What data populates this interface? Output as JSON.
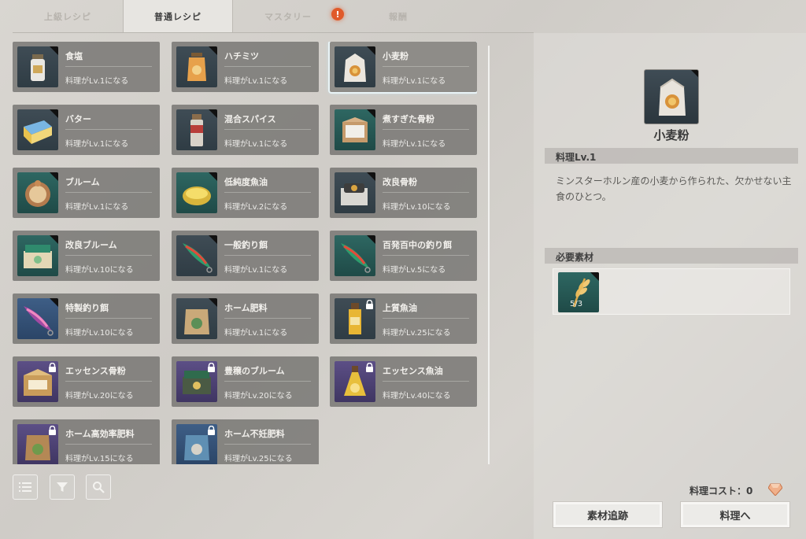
{
  "tabs": [
    {
      "label": "上級レシピ"
    },
    {
      "label": "普通レシピ"
    },
    {
      "label": "マスタリー"
    },
    {
      "label": "報酬"
    }
  ],
  "alert_badge": "!",
  "recipes": [
    {
      "name": "食塩",
      "req": "料理がLv.1になる",
      "icon": "salt-jar-icon",
      "locked": false
    },
    {
      "name": "ハチミツ",
      "req": "料理がLv.1になる",
      "icon": "honey-jar-icon",
      "locked": false
    },
    {
      "name": "小麦粉",
      "req": "料理がLv.1になる",
      "icon": "flour-bag-icon",
      "locked": false,
      "selected": true
    },
    {
      "name": "バター",
      "req": "料理がLv.1になる",
      "icon": "butter-icon",
      "locked": false
    },
    {
      "name": "混合スパイス",
      "req": "料理がLv.1になる",
      "icon": "spice-bottle-icon",
      "locked": false
    },
    {
      "name": "煮すぎた骨粉",
      "req": "料理がLv.1になる",
      "icon": "bone-meal-box-icon",
      "locked": false
    },
    {
      "name": "ブルーム",
      "req": "料理がLv.1になる",
      "icon": "bloom-compass-icon",
      "locked": false
    },
    {
      "name": "低純度魚油",
      "req": "料理がLv.2になる",
      "icon": "fish-oil-bowl-icon",
      "locked": false
    },
    {
      "name": "改良骨粉",
      "req": "料理がLv.10になる",
      "icon": "improved-bone-meal-icon",
      "locked": false
    },
    {
      "name": "改良ブルーム",
      "req": "料理がLv.10になる",
      "icon": "improved-bloom-box-icon",
      "locked": false
    },
    {
      "name": "一般釣り餌",
      "req": "料理がLv.1になる",
      "icon": "fishing-lure-icon",
      "locked": false
    },
    {
      "name": "百発百中の釣り餌",
      "req": "料理がLv.5になる",
      "icon": "fishing-lure-icon",
      "locked": false
    },
    {
      "name": "特製釣り餌",
      "req": "料理がLv.10になる",
      "icon": "special-lure-icon",
      "locked": false
    },
    {
      "name": "ホーム肥料",
      "req": "料理がLv.1になる",
      "icon": "fertilizer-sack-icon",
      "locked": false
    },
    {
      "name": "上質魚油",
      "req": "料理がLv.25になる",
      "icon": "fish-oil-bottle-icon",
      "locked": true
    },
    {
      "name": "エッセンス骨粉",
      "req": "料理がLv.20になる",
      "icon": "essence-bone-meal-icon",
      "locked": true
    },
    {
      "name": "豊穣のブルーム",
      "req": "料理がLv.20になる",
      "icon": "harvest-bloom-box-icon",
      "locked": true
    },
    {
      "name": "エッセンス魚油",
      "req": "料理がLv.40になる",
      "icon": "essence-oil-flask-icon",
      "locked": true
    },
    {
      "name": "ホーム高効率肥料",
      "req": "料理がLv.15になる",
      "icon": "efficient-fertilizer-icon",
      "locked": true
    },
    {
      "name": "ホーム不妊肥料",
      "req": "料理がLv.25になる",
      "icon": "sterile-fertilizer-icon",
      "locked": true
    }
  ],
  "toolbar": {
    "list_icon": "list-icon",
    "filter_icon": "filter-icon",
    "search_icon": "search-icon"
  },
  "detail": {
    "name": "小麦粉",
    "level": "料理Lv.1",
    "description": "ミンスターホルン産の小麦から作られた、欠かせない主食のひとつ。",
    "materials_label": "必要素材",
    "materials": [
      {
        "icon": "wheat-icon",
        "count": "5/3"
      }
    ],
    "cost_label": "料理コスト：0",
    "track_button": "素材追跡",
    "cook_button": "料理へ"
  }
}
